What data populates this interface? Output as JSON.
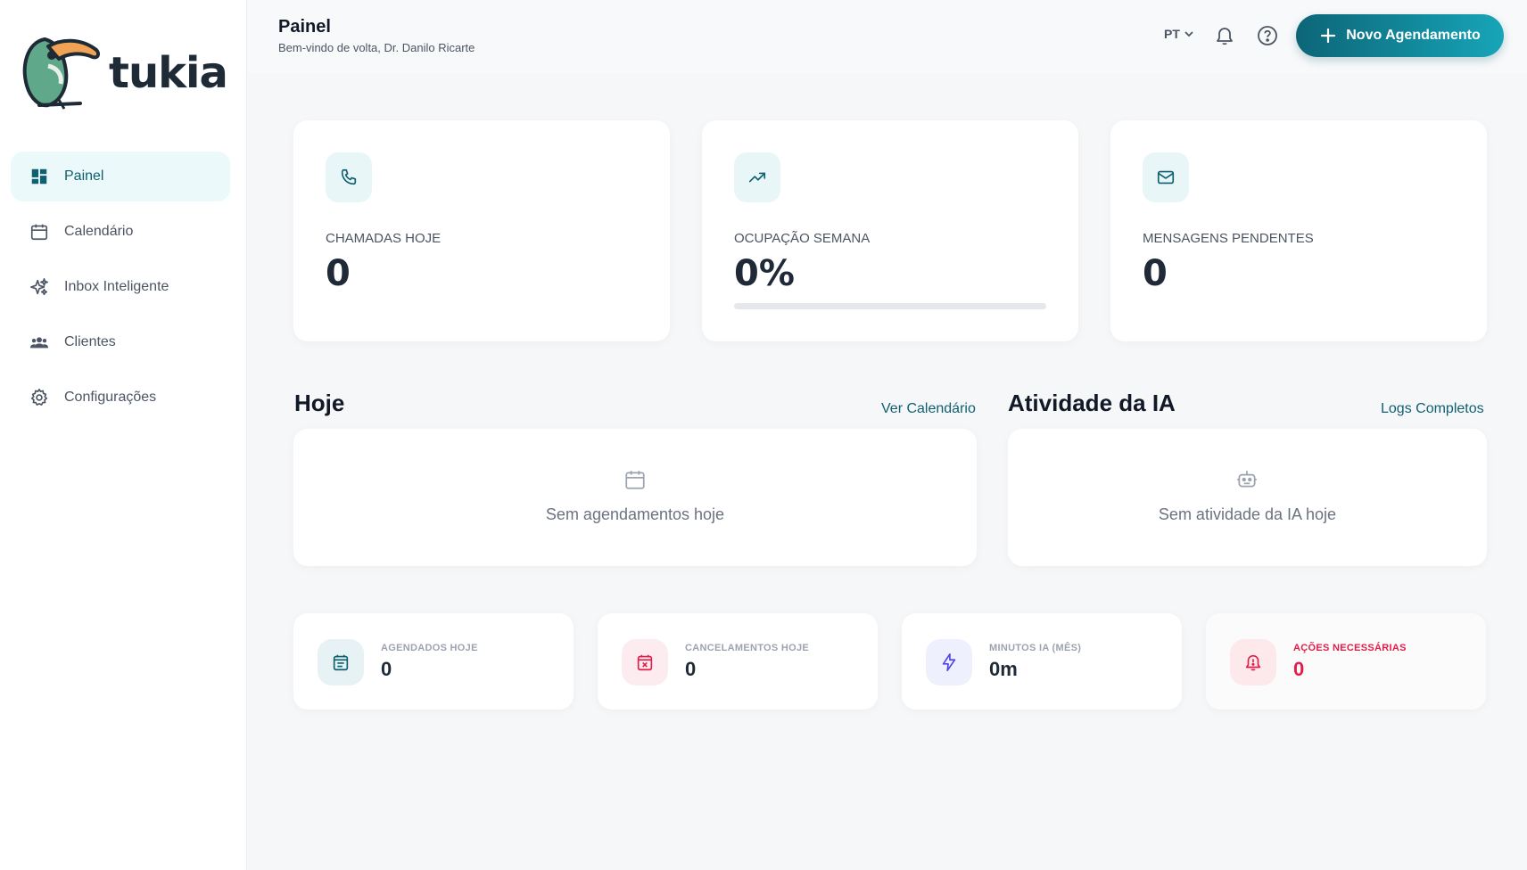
{
  "brand": {
    "name": "tukia"
  },
  "sidebar": {
    "items": [
      {
        "label": "Painel",
        "icon": "dashboard-icon",
        "active": true
      },
      {
        "label": "Calendário",
        "icon": "calendar-icon"
      },
      {
        "label": "Inbox Inteligente",
        "icon": "sparkles-icon"
      },
      {
        "label": "Clientes",
        "icon": "users-icon"
      },
      {
        "label": "Configurações",
        "icon": "gear-icon"
      }
    ]
  },
  "header": {
    "title": "Painel",
    "subtitle": "Bem-vindo de volta, Dr. Danilo Ricarte",
    "language": "PT",
    "new_button": "Novo Agendamento"
  },
  "stats": [
    {
      "label": "CHAMADAS HOJE",
      "value": "0",
      "icon": "phone-icon"
    },
    {
      "label": "OCUPAÇÃO SEMANA",
      "value": "0%",
      "icon": "trending-up-icon",
      "progress_percent": 0
    },
    {
      "label": "MENSAGENS PENDENTES",
      "value": "0",
      "icon": "mail-icon"
    }
  ],
  "today": {
    "title": "Hoje",
    "link": "Ver Calendário",
    "empty_text": "Sem agendamentos hoje"
  },
  "ai_activity": {
    "title": "Atividade da IA",
    "link": "Logs Completos",
    "empty_text": "Sem atividade da IA hoje"
  },
  "mini_stats": [
    {
      "label": "AGENDADOS HOJE",
      "value": "0",
      "icon": "calendar-list-icon",
      "color": "#0e5f70",
      "bg": "#e6f2f3"
    },
    {
      "label": "CANCELAMENTOS HOJE",
      "value": "0",
      "icon": "calendar-x-icon",
      "color": "#e11d48",
      "bg": "#fdecef"
    },
    {
      "label": "MINUTOS IA (MÊS)",
      "value": "0m",
      "icon": "lightning-icon",
      "color": "#4f46e5",
      "bg": "#eef0fd"
    },
    {
      "label": "AÇÕES NECESSÁRIAS",
      "value": "0",
      "icon": "bell-alert-icon",
      "color": "#e11d48",
      "bg": "#fde8ec"
    }
  ],
  "colors": {
    "accent": "#0e5f70",
    "accent_light": "#17a5b8",
    "alert": "#e11d48"
  }
}
